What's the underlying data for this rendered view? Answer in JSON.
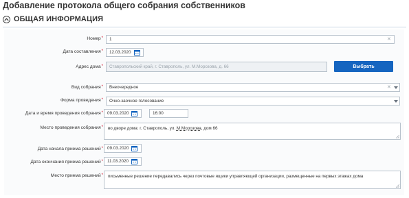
{
  "page": {
    "title": "Добавление протокола общего собрания собственников"
  },
  "section": {
    "title": "ОБЩАЯ ИНФОРМАЦИЯ",
    "toggle_icon": "chevron-up-circle-icon"
  },
  "form": {
    "number": {
      "label": "Номер",
      "value": "1"
    },
    "date_compiled": {
      "label": "Дата составления",
      "value": "12.03.2020"
    },
    "address": {
      "label": "Адрес дома",
      "value": "Ставропольский край, г. Ставрополь, ул. М.Морозова, д. 66",
      "button": "Выбрать"
    },
    "meeting_type": {
      "label": "Вид собрания",
      "value": "Внеочередное"
    },
    "meeting_form": {
      "label": "Форма проведения",
      "value": "Очно-заочное голосование"
    },
    "meeting_datetime": {
      "label": "Дата и время проведения собрания",
      "date": "09.03.2020",
      "time": "16:00"
    },
    "meeting_place": {
      "label": "Место проведения собрания",
      "text_prefix": "во дворе дома: ",
      "text_mid": "г. Ставрополь, ул. ",
      "text_link": "М.Морозова",
      "text_suffix": ", дом 66"
    },
    "decisions_start": {
      "label": "Дата начала приема решений",
      "value": "09.03.2020"
    },
    "decisions_end": {
      "label": "Дата окончания приема решений",
      "value": "11.03.2020"
    },
    "decisions_place": {
      "label": "Место приема решений",
      "value": "письменные решение передавались через почтовые ящики управляющей организации, размещенные на первых этажах дома"
    }
  },
  "colors": {
    "accent": "#1565c0",
    "required": "#d0021b",
    "border": "#b8c2cc"
  }
}
